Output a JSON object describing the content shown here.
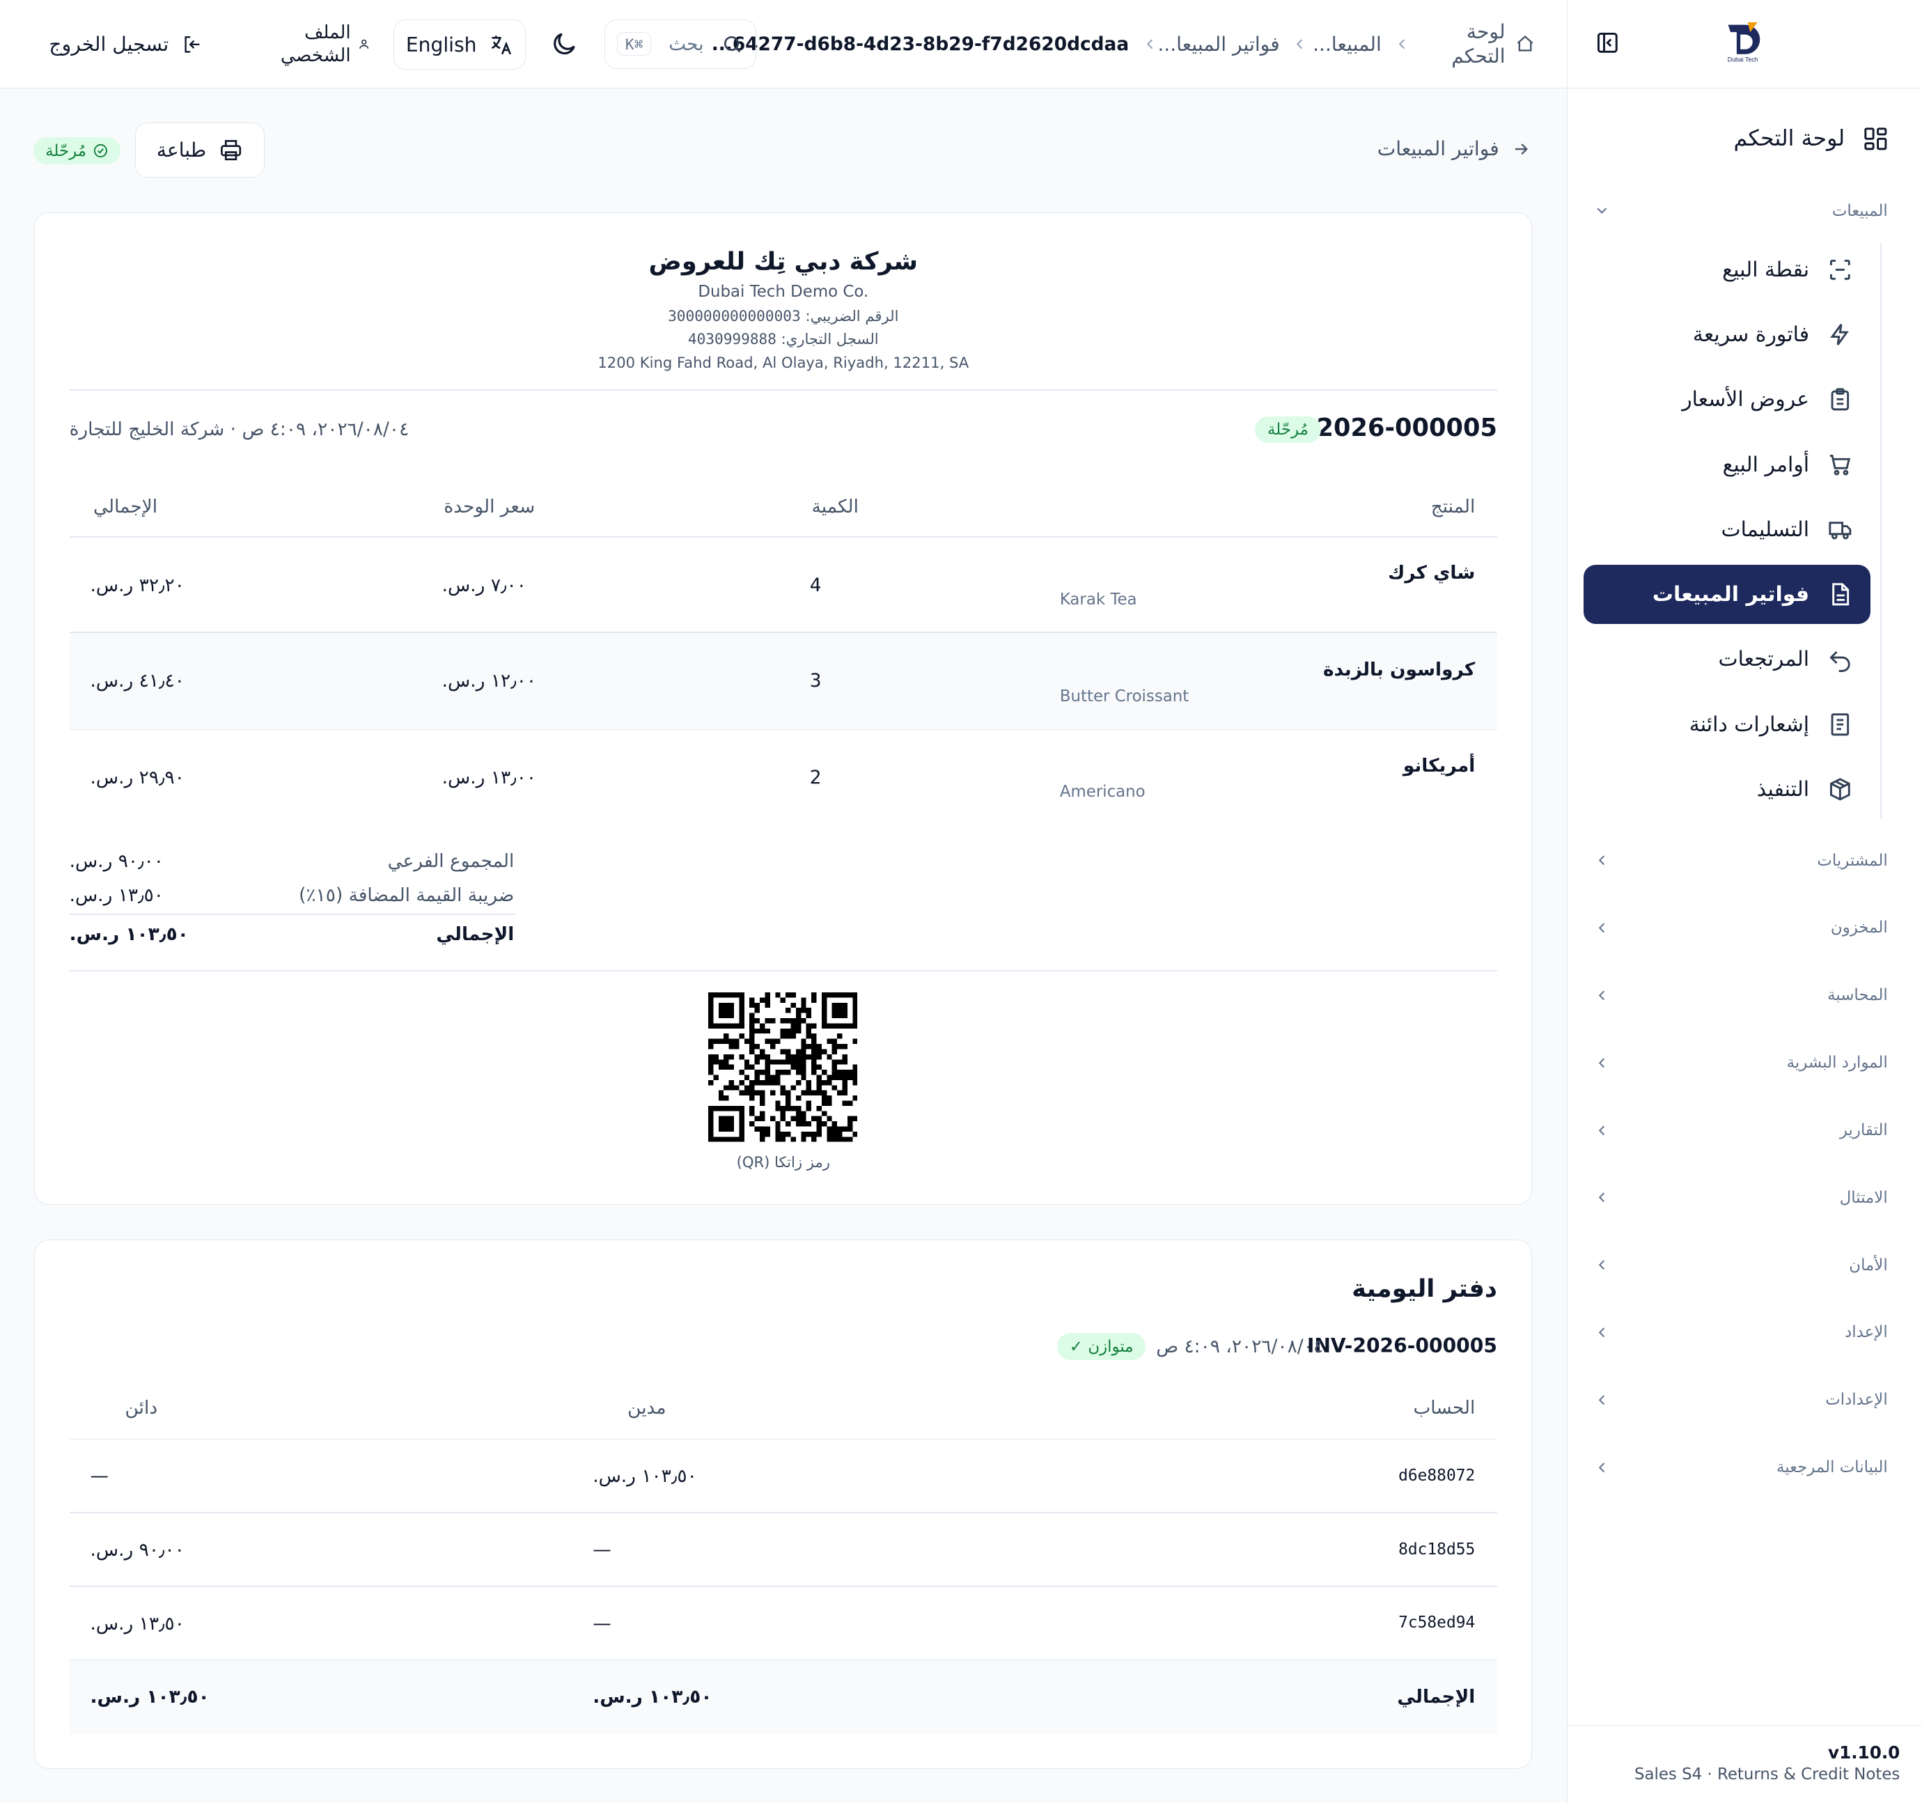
{
  "sidebar": {
    "dashboard_label": "لوحة التحكم",
    "sales_group": "المبيعات",
    "items": [
      {
        "label": "نقطة البيع"
      },
      {
        "label": "فاتورة سريعة"
      },
      {
        "label": "عروض الأسعار"
      },
      {
        "label": "أوامر البيع"
      },
      {
        "label": "التسليمات"
      },
      {
        "label": "فواتير المبيعات"
      },
      {
        "label": "المرتجعات"
      },
      {
        "label": "إشعارات دائنة"
      },
      {
        "label": "التنفيذ"
      }
    ],
    "groups": [
      {
        "label": "المشتريات"
      },
      {
        "label": "المخزون"
      },
      {
        "label": "المحاسبة"
      },
      {
        "label": "الموارد البشرية"
      },
      {
        "label": "التقارير"
      },
      {
        "label": "الامتثال"
      },
      {
        "label": "الأمان"
      },
      {
        "label": "الإعداد"
      },
      {
        "label": "الإعدادات"
      },
      {
        "label": "البيانات المرجعية"
      }
    ],
    "version": "v1.10.0",
    "release": "Sales S4 · Returns & Credit Notes",
    "logo_text": "Dubai Tech"
  },
  "header": {
    "breadcrumb": {
      "home": "لوحة التحكم",
      "sales": "المبيعا...",
      "invoices": "فواتير المبيعا...",
      "current": "...64277-d6b8-4d23-8b29-f7d2620dcdaa"
    },
    "search_placeholder": "بحث",
    "search_shortcut": "⌘K",
    "language_label": "English",
    "profile_label": "الملف الشخصي",
    "logout_label": "تسجيل الخروج"
  },
  "page": {
    "back_label": "فواتير المبيعات",
    "print_label": "طباعة",
    "status_label": "مُرحّلة"
  },
  "invoice": {
    "company_ar": "شركة دبي تِك للعروض",
    "company_en": "Dubai Tech Demo Co.",
    "tax_label": "الرقم الضريبي:",
    "tax_number": "300000000000003",
    "cr_label": "السجل التجاري:",
    "cr_number": "4030999888",
    "address": "1200 King Fahd Road, Al Olaya, Riyadh, 12211, SA",
    "number": "INV-2026-000005",
    "status": "مُرحّلة",
    "meta": "٢٠٢٦/٠٨/٠٤، ٤:٠٩ ص · شركة الخليج للتجارة",
    "columns": {
      "product": "المنتج",
      "qty": "الكمية",
      "unit_price": "سعر الوحدة",
      "total": "الإجمالي"
    },
    "lines": [
      {
        "name_ar": "شاي كرك",
        "name_en": "Karak Tea",
        "qty": "4",
        "price": "٧٫٠٠ ر.س.",
        "total": "٣٢٫٢٠ ر.س."
      },
      {
        "name_ar": "كرواسون بالزبدة",
        "name_en": "Butter Croissant",
        "qty": "3",
        "price": "١٢٫٠٠ ر.س.",
        "total": "٤١٫٤٠ ر.س."
      },
      {
        "name_ar": "أمريكانو",
        "name_en": "Americano",
        "qty": "2",
        "price": "١٣٫٠٠ ر.س.",
        "total": "٢٩٫٩٠ ر.س."
      }
    ],
    "totals": {
      "subtotal_label": "المجموع الفرعي",
      "subtotal": "٩٠٫٠٠ ر.س.",
      "vat_label": "ضريبة القيمة المضافة (١٥٪)",
      "vat": "١٣٫٥٠ ر.س.",
      "total_label": "الإجمالي",
      "total": "١٠٣٫٥٠ ر.س."
    },
    "qr_caption": "رمز زاتكا (QR)"
  },
  "journal": {
    "title": "دفتر اليومية",
    "number": "INV-2026-000005",
    "date": "٢٠٢٦/٠٨/٠٤، ٤:٠٩ ص",
    "balanced_label": "متوازن ✓",
    "columns": {
      "account": "الحساب",
      "debit": "مدين",
      "credit": "دائن"
    },
    "rows": [
      {
        "account": "d6e88072",
        "debit": "١٠٣٫٥٠ ر.س.",
        "credit": "—"
      },
      {
        "account": "8dc18d55",
        "debit": "—",
        "credit": "٩٠٫٠٠ ر.س."
      },
      {
        "account": "7c58ed94",
        "debit": "—",
        "credit": "١٣٫٥٠ ر.س."
      }
    ],
    "total_label": "الإجمالي",
    "total_debit": "١٠٣٫٥٠ ر.س.",
    "total_credit": "١٠٣٫٥٠ ر.س."
  },
  "colors": {
    "primary": "#1e2a5e",
    "success_bg": "#dcfce7",
    "success_text": "#15803d",
    "border": "#e2e8f0"
  }
}
